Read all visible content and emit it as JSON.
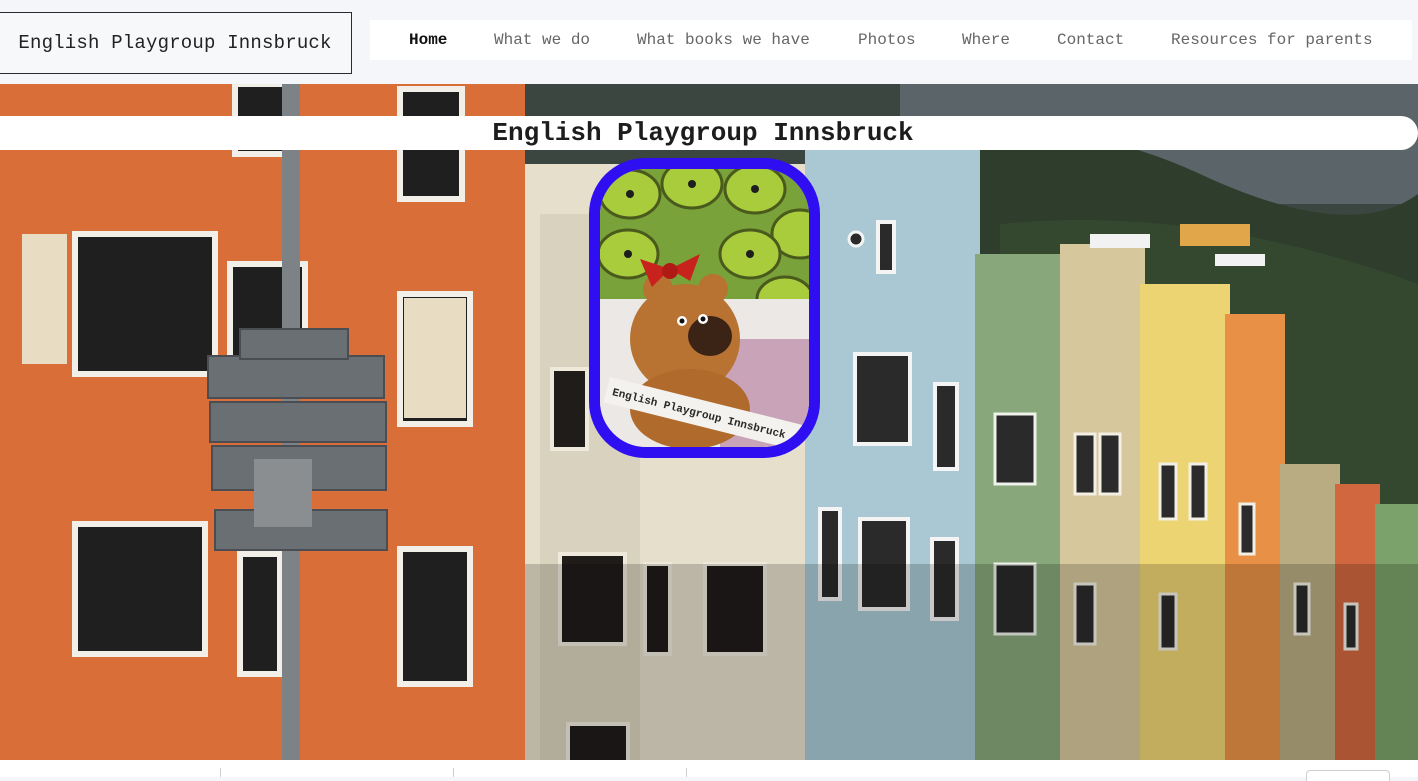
{
  "site": {
    "logo_text": "English Playgroup Innsbruck"
  },
  "nav": {
    "items": [
      {
        "label": "Home",
        "active": true
      },
      {
        "label": "What we do",
        "active": false
      },
      {
        "label": "What books we have",
        "active": false
      },
      {
        "label": "Photos",
        "active": false
      },
      {
        "label": "Where",
        "active": false
      },
      {
        "label": "Contact",
        "active": false
      },
      {
        "label": "Resources for parents",
        "active": false
      }
    ]
  },
  "hero": {
    "title": "English Playgroup Innsbruck",
    "photo_caption": "English Playgroup Innsbruck"
  },
  "colors": {
    "frame_accent": "#2f0ff2",
    "nav_active": "#111111",
    "nav_inactive": "#666666"
  }
}
